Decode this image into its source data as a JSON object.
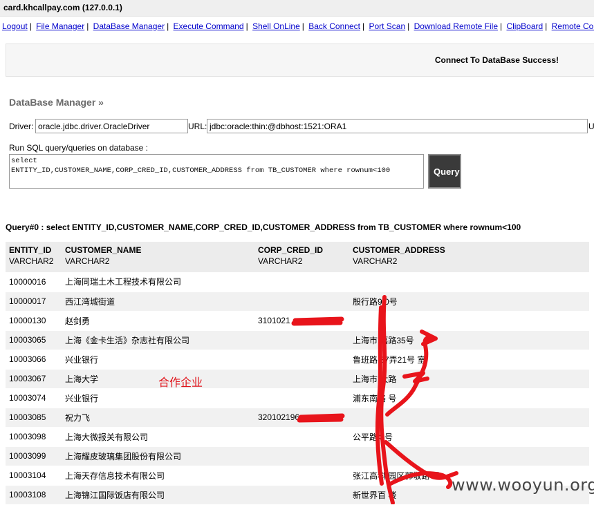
{
  "window": {
    "title": "card.khcallpay.com (127.0.0.1)"
  },
  "nav": {
    "separator": "|",
    "links": [
      "Logout",
      "File Manager",
      "DataBase Manager",
      "Execute Command",
      "Shell OnLine",
      "Back Connect",
      "Port Scan",
      "Download Remote File",
      "ClipBoard",
      "Remote Control"
    ]
  },
  "status": {
    "message": "Connect To DataBase Success!"
  },
  "db_manager": {
    "title": "DataBase Manager »",
    "driver_label": "Driver:",
    "driver_value": "oracle.jdbc.driver.OracleDriver",
    "url_label": "URL:",
    "url_value": "jdbc:oracle:thin:@dbhost:1521:ORA1",
    "url_trailing": "U",
    "sql_label": "Run SQL query/queries on database :",
    "sql_value": "select\nENTITY_ID,CUSTOMER_NAME,CORP_CRED_ID,CUSTOMER_ADDRESS from TB_CUSTOMER where rownum<100",
    "query_button": "Query"
  },
  "results": {
    "title": "Query#0 : select ENTITY_ID,CUSTOMER_NAME,CORP_CRED_ID,CUSTOMER_ADDRESS from TB_CUSTOMER where rownum<100",
    "columns": [
      {
        "name": "ENTITY_ID",
        "type": "VARCHAR2"
      },
      {
        "name": "CUSTOMER_NAME",
        "type": "VARCHAR2"
      },
      {
        "name": "CORP_CRED_ID",
        "type": "VARCHAR2"
      },
      {
        "name": "CUSTOMER_ADDRESS",
        "type": "VARCHAR2"
      }
    ],
    "rows": [
      [
        "10000016",
        "上海同瑞土木工程技术有限公司",
        "",
        ""
      ],
      [
        "10000017",
        "西江湾城街道",
        "",
        "殷行路9  0号"
      ],
      [
        "10000130",
        "赵剑勇",
        "3101021",
        ""
      ],
      [
        "10003065",
        "上海《金卡生活》杂志社有限公司",
        "",
        "上海市 嘉路35号"
      ],
      [
        "10003066",
        "兴业银行",
        "",
        "鲁班路 37弄21号  室"
      ],
      [
        "10003067",
        "上海大学",
        "",
        "上海市 大路"
      ],
      [
        "10003074",
        "兴业银行",
        "",
        "浦东南路   号"
      ],
      [
        "10003085",
        "祝力飞",
        "320102196",
        ""
      ],
      [
        "10003098",
        "上海大微报关有限公司",
        "",
        "公平路4  号"
      ],
      [
        "10003099",
        "上海耀皮玻璃集团股份有限公司",
        "",
        ""
      ],
      [
        "10003104",
        "上海天存信息技术有限公司",
        "",
        "张江高科  园区郭敬路  号"
      ],
      [
        "10003108",
        "上海锦江国际饭店有限公司",
        "",
        "新世界百  楼"
      ]
    ]
  },
  "annotation": {
    "text": "合作企业",
    "color": "#e0141b"
  },
  "watermark": {
    "text": "www.wooyun.org"
  }
}
